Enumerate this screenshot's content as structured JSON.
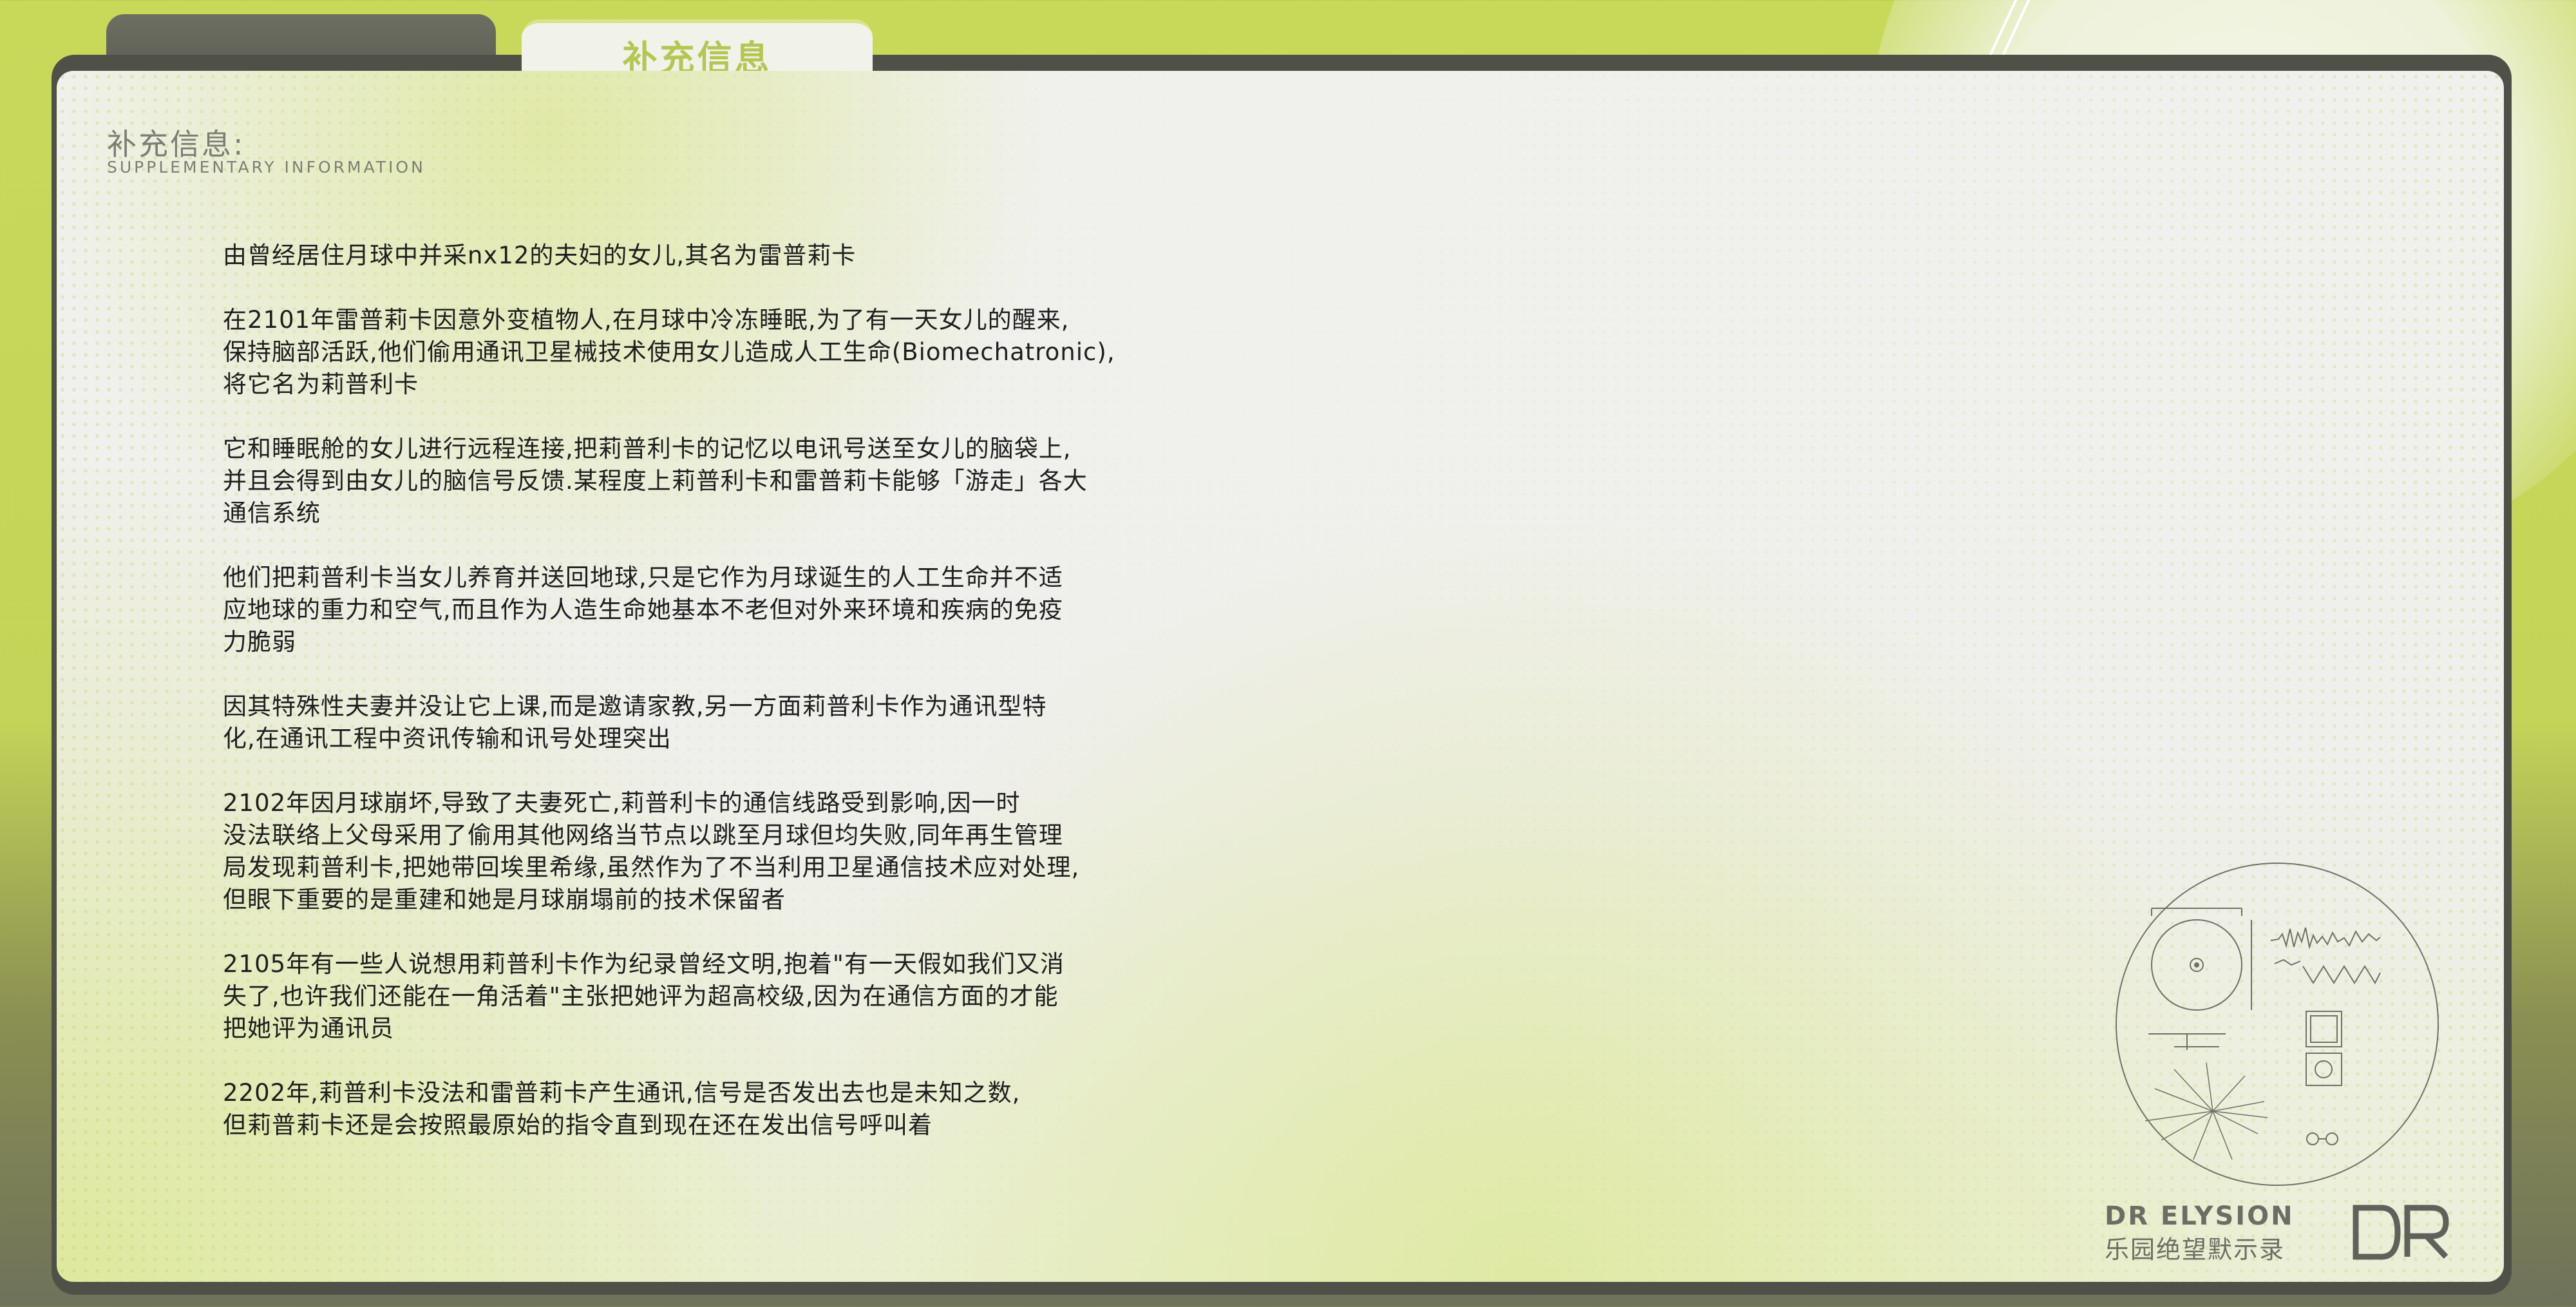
{
  "tabs": [
    {
      "label": ""
    },
    {
      "label": "补充信息",
      "active": true
    }
  ],
  "header": {
    "title": "补充信息:",
    "subtitle": "SUPPLEMENTARY INFORMATION"
  },
  "paragraphs": [
    "由曾经居住月球中并采nx12的夫妇的女儿,其名为雷普莉卡",
    "在2101年雷普莉卡因意外变植物人,在月球中冷冻睡眠,为了有一天女儿的醒来,\n保持脑部活跃,他们偷用通讯卫星械技术使用女儿造成人工生命(Biomechatronic),\n将它名为莉普利卡",
    "它和睡眠舱的女儿进行远程连接,把莉普利卡的记忆以电讯号送至女儿的脑袋上,\n并且会得到由女儿的脑信号反馈.某程度上莉普利卡和雷普莉卡能够「游走」各大\n通信系统",
    "他们把莉普利卡当女儿养育并送回地球,只是它作为月球诞生的人工生命并不适\n应地球的重力和空气,而且作为人造生命她基本不老但对外来环境和疾病的免疫\n力脆弱",
    "因其特殊性夫妻并没让它上课,而是邀请家教,另一方面莉普利卡作为通讯型特\n化,在通讯工程中资讯传输和讯号处理突出",
    "2102年因月球崩坏,导致了夫妻死亡,莉普利卡的通信线路受到影响,因一时\n没法联络上父母采用了偷用其他网络当节点以跳至月球但均失败,同年再生管理\n局发现莉普利卡,把她带回埃里希缘,虽然作为了不当利用卫星通信技术应对处理,\n但眼下重要的是重建和她是月球崩塌前的技术保留者",
    "2105年有一些人说想用莉普利卡作为纪录曾经文明,抱着\"有一天假如我们又消\n失了,也许我们还能在一角活着\"主张把她评为超高校级,因为在通信方面的才能\n把她评为通讯员",
    "2202年,莉普利卡没法和雷普莉卡产生通讯,信号是否发出去也是未知之数,\n但莉普莉卡还是会按照最原始的指令直到现在还在发出信号呼叫着"
  ],
  "logo": {
    "en": "DR ELYSION",
    "cn": "乐园绝望默示录",
    "mark": "DR"
  },
  "colors": {
    "accent": "#c8d95a",
    "tab_label": "#b6c652",
    "frame": "#4f5149",
    "text": "#1e1e1e",
    "muted": "#7b7f73"
  },
  "icons": {
    "record": "golden-record-diagram-icon",
    "logo": "dr-elysion-logo-icon"
  }
}
